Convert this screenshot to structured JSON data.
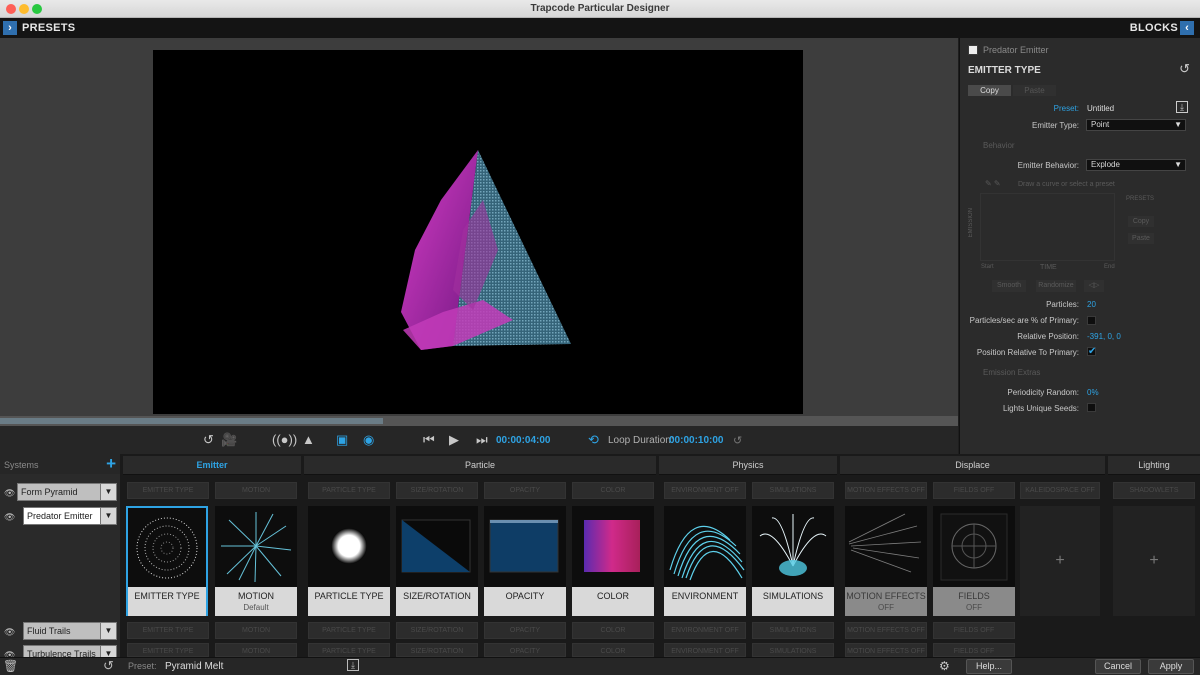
{
  "window": {
    "title": "Trapcode Particular Designer"
  },
  "header": {
    "left_label": "PRESETS",
    "right_label": "BLOCKS"
  },
  "transport": {
    "current_time": "00:00:04:00",
    "loop_label": "Loop Duration:",
    "loop_duration": "00:00:10:00",
    "progress_fraction": 0.4
  },
  "panel": {
    "breadcrumb": "Predator Emitter",
    "title": "EMITTER TYPE",
    "copy_label": "Copy",
    "paste_label": "Paste",
    "preset_label": "Preset:",
    "preset_value": "Untitled",
    "emitter_type_label": "Emitter Type:",
    "emitter_type_value": "Point",
    "behavior_section": "Behavior",
    "emitter_behavior_label": "Emitter Behavior:",
    "emitter_behavior_value": "Explode",
    "curve_hint": "Draw a curve or select a preset",
    "presets_label": "PRESETS",
    "copy2": "Copy",
    "paste2": "Paste",
    "emission_axis": "EMISSION",
    "axis_start": "Start",
    "axis_time": "TIME",
    "axis_end": "End",
    "smooth_btn": "Smooth",
    "randomize_btn": "Randomize",
    "particles_label": "Particles:",
    "particles_value": "20",
    "pps_label": "Particles/sec are % of Primary:",
    "rel_pos_label": "Relative Position:",
    "rel_pos_value": "-391, 0, 0",
    "pos_rel_label": "Position Relative To Primary:",
    "extras_section": "Emission Extras",
    "periodicity_label": "Periodicity Random:",
    "periodicity_value": "0%",
    "seeds_label": "Lights Unique Seeds:"
  },
  "systems": {
    "header": "Systems",
    "items": [
      "Form Pyramid",
      "Predator Emitter",
      "Fluid Trails",
      "Turbulence Trails"
    ]
  },
  "categories": {
    "emitter": "Emitter",
    "particle": "Particle",
    "physics": "Physics",
    "displace": "Displace",
    "lighting": "Lighting"
  },
  "ghosts": {
    "emitter_type": "EMITTER TYPE",
    "motion": "MOTION",
    "particle_type": "PARTICLE TYPE",
    "size_rotation": "SIZE/ROTATION",
    "opacity": "OPACITY",
    "color": "COLOR",
    "environment": "ENVIRONMENT OFF",
    "simulations": "SIMULATIONS",
    "motion_effects": "MOTION EFFECTS OFF",
    "fields": "FIELDS OFF",
    "kaleidospace": "KALEIDOSPACE OFF",
    "shadowlets": "SHADOWLETS"
  },
  "blocks": {
    "emitter_type": "EMITTER TYPE",
    "motion": "MOTION",
    "motion_sub": "Default",
    "particle_type": "PARTICLE TYPE",
    "size_rotation": "SIZE/ROTATION",
    "opacity": "OPACITY",
    "color": "COLOR",
    "environment": "ENVIRONMENT",
    "simulations": "SIMULATIONS",
    "motion_effects": "MOTION EFFECTS",
    "motion_effects_sub": "OFF",
    "fields": "FIELDS",
    "fields_sub": "OFF"
  },
  "footer": {
    "preset_label": "Preset:",
    "preset_value": "Pyramid Melt",
    "help": "Help...",
    "cancel": "Cancel",
    "apply": "Apply"
  },
  "colors": {
    "accent": "#2ea3e4",
    "selected_border": "#2ea3e4"
  }
}
